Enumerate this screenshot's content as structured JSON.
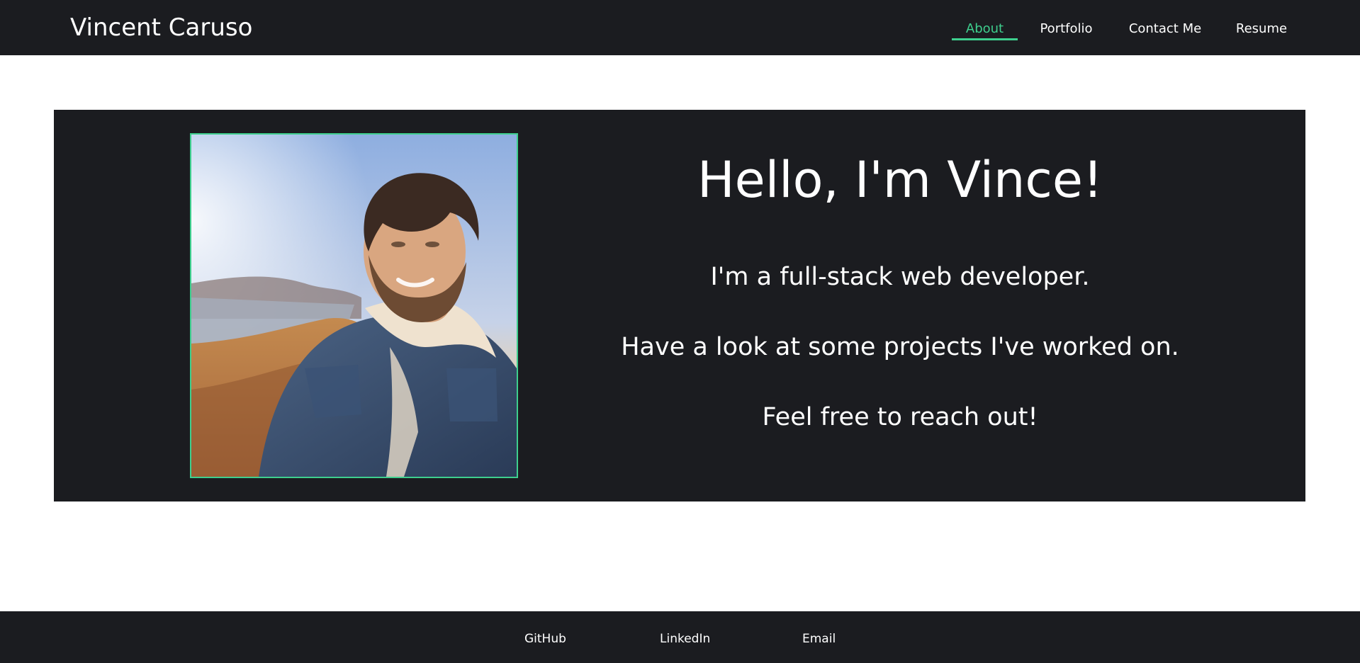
{
  "header": {
    "brand": "Vincent Caruso",
    "nav": [
      {
        "label": "About",
        "active": true
      },
      {
        "label": "Portfolio",
        "active": false
      },
      {
        "label": "Contact Me",
        "active": false
      },
      {
        "label": "Resume",
        "active": false
      }
    ]
  },
  "hero": {
    "title": "Hello, I'm Vince!",
    "lines": [
      "I'm a full-stack web developer.",
      "Have a look at some projects I've worked on.",
      "Feel free to reach out!"
    ]
  },
  "footer": {
    "links": [
      "GitHub",
      "LinkedIn",
      "Email"
    ]
  },
  "colors": {
    "dark": "#1b1c20",
    "accent": "#3ecf8e",
    "text": "#ffffff"
  }
}
